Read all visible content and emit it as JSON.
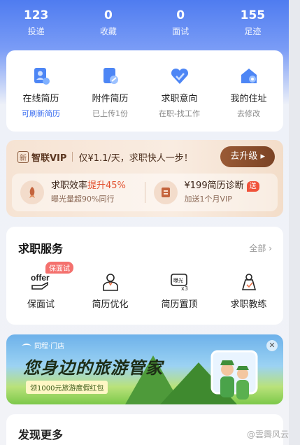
{
  "stats": [
    {
      "num": "123",
      "label": "投递"
    },
    {
      "num": "0",
      "label": "收藏"
    },
    {
      "num": "0",
      "label": "面试"
    },
    {
      "num": "155",
      "label": "足迹"
    }
  ],
  "resume": [
    {
      "title": "在线简历",
      "sub": "可刷新简历",
      "icon": "online-resume-icon"
    },
    {
      "title": "附件简历",
      "sub": "已上传1份",
      "icon": "attachment-resume-icon"
    },
    {
      "title": "求职意向",
      "sub": "在职-找工作",
      "icon": "job-intention-icon"
    },
    {
      "title": "我的住址",
      "sub": "去修改",
      "icon": "address-icon"
    }
  ],
  "vip": {
    "badge": "新",
    "name": "智联VIP",
    "slogan": "仅¥1.1/天，求职快人一步！",
    "button": "去升级 ▸",
    "left_title_a": "求职效率",
    "left_title_b": "提升45%",
    "left_sub": "曝光量超90%同行",
    "right_title": "¥199简历诊断",
    "right_tag": "送",
    "right_sub": "加送1个月VIP"
  },
  "services": {
    "title": "求职服务",
    "all": "全部 ›",
    "tag": "保面试",
    "items": [
      {
        "label": "保面试",
        "icon": "offer-icon"
      },
      {
        "label": "简历优化",
        "icon": "resume-optimize-icon"
      },
      {
        "label": "简历置顶",
        "icon": "resume-top-icon"
      },
      {
        "label": "求职教练",
        "icon": "coach-icon"
      }
    ]
  },
  "banner": {
    "brand": "同程·门店",
    "main": "您身边的旅游管家",
    "sub": "领1000元旅游度假红包",
    "close": "✕"
  },
  "discover": {
    "title": "发现更多"
  },
  "watermark": "@雲霽风云"
}
